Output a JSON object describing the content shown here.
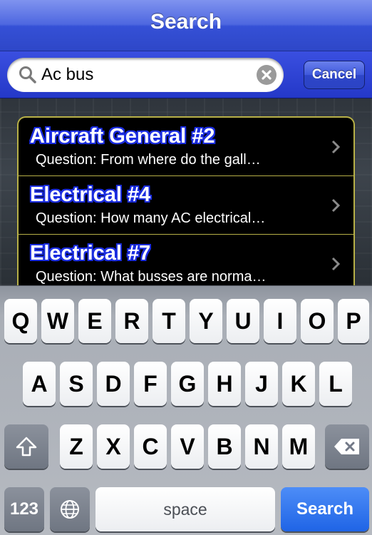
{
  "navbar": {
    "title": "Search"
  },
  "search": {
    "value": "Ac bus",
    "cancel_label": "Cancel"
  },
  "results": [
    {
      "title": "Aircraft General #2",
      "subtitle": "Question: From where do the gall…"
    },
    {
      "title": "Electrical #4",
      "subtitle": "Question: How many AC electrical…"
    },
    {
      "title": "Electrical #7",
      "subtitle": "Question: What busses are norma…"
    }
  ],
  "keyboard": {
    "row1": [
      "Q",
      "W",
      "E",
      "R",
      "T",
      "Y",
      "U",
      "I",
      "O",
      "P"
    ],
    "row2": [
      "A",
      "S",
      "D",
      "F",
      "G",
      "H",
      "J",
      "K",
      "L"
    ],
    "row3": [
      "Z",
      "X",
      "C",
      "V",
      "B",
      "N",
      "M"
    ],
    "numbers_label": "123",
    "space_label": "space",
    "search_label": "Search"
  },
  "colors": {
    "nav_blue": "#3550d6",
    "row_border": "#b7b047",
    "title_outline": "#1b2de0",
    "search_key": "#1f64e6"
  },
  "icons": [
    "search-icon",
    "clear-icon",
    "chevron-right-icon",
    "shift-icon",
    "backspace-icon",
    "globe-icon"
  ]
}
